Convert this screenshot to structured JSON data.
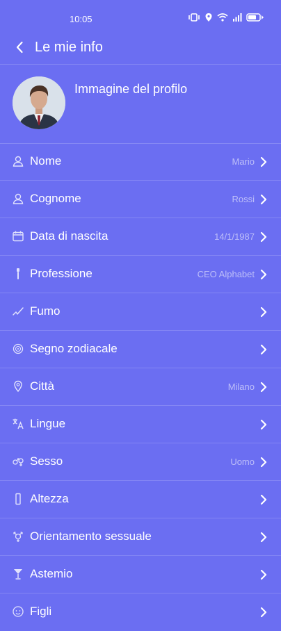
{
  "colors": {
    "background": "#6b6ef2",
    "text": "#ffffff"
  },
  "status_bar": {
    "time": "10:05"
  },
  "header": {
    "title": "Le mie info",
    "back_icon": "chevron-left-icon"
  },
  "profile": {
    "label": "Immagine del profilo"
  },
  "rows": [
    {
      "id": "nome",
      "icon": "person-icon",
      "label": "Nome",
      "value": "Mario"
    },
    {
      "id": "cognome",
      "icon": "person-icon",
      "label": "Cognome",
      "value": "Rossi"
    },
    {
      "id": "data-nascita",
      "icon": "calendar-icon",
      "label": "Data di nascita",
      "value": "14/1/1987"
    },
    {
      "id": "professione",
      "icon": "tool-icon",
      "label": "Professione",
      "value": "CEO Alphabet"
    },
    {
      "id": "fumo",
      "icon": "cigarette-icon",
      "label": "Fumo",
      "value": ""
    },
    {
      "id": "segno-zodiacale",
      "icon": "zodiac-icon",
      "label": "Segno zodiacale",
      "value": ""
    },
    {
      "id": "citta",
      "icon": "location-pin-icon",
      "label": "Città",
      "value": "Milano"
    },
    {
      "id": "lingue",
      "icon": "language-icon",
      "label": "Lingue",
      "value": ""
    },
    {
      "id": "sesso",
      "icon": "gender-icon",
      "label": "Sesso",
      "value": "Uomo"
    },
    {
      "id": "altezza",
      "icon": "ruler-icon",
      "label": "Altezza",
      "value": ""
    },
    {
      "id": "orientamento",
      "icon": "orientation-icon",
      "label": "Orientamento sessuale",
      "value": ""
    },
    {
      "id": "astemio",
      "icon": "glass-icon",
      "label": "Astemio",
      "value": ""
    },
    {
      "id": "figli",
      "icon": "baby-icon",
      "label": "Figli",
      "value": ""
    }
  ]
}
